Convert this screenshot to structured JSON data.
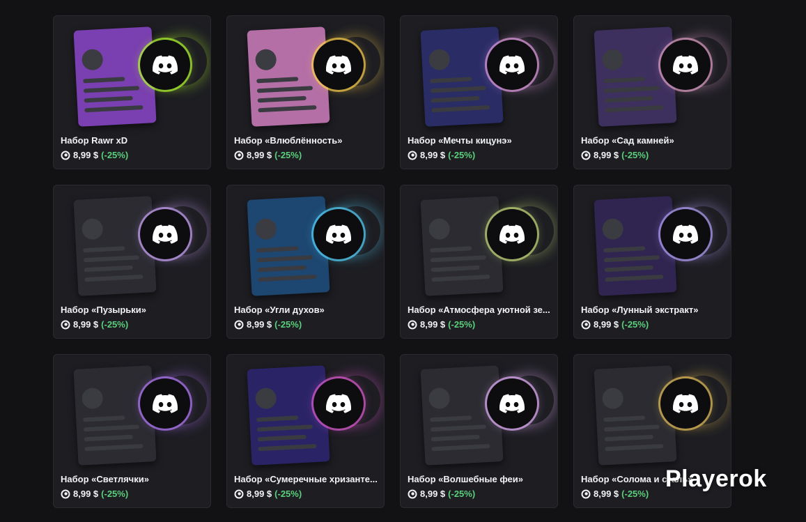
{
  "currency_icon": "orb-icon",
  "items": [
    {
      "title": "Набор Rawr xD",
      "price": "8,99 $",
      "discount": "(-25%)",
      "bg": "#7a3fb0",
      "accent": "#b6ff2e"
    },
    {
      "title": "Набор «Влюблённость»",
      "price": "8,99 $",
      "discount": "(-25%)",
      "bg": "#b46fa7",
      "accent": "#ffd24a"
    },
    {
      "title": "Набор «Мечты кицунэ»",
      "price": "8,99 $",
      "discount": "(-25%)",
      "bg": "#2a2c66",
      "accent": "#e7a0e6"
    },
    {
      "title": "Набор «Сад камней»",
      "price": "8,99 $",
      "discount": "(-25%)",
      "bg": "#3d2f5e",
      "accent": "#e2a0c8"
    },
    {
      "title": "Набор «Пузырьки»",
      "price": "8,99 $",
      "discount": "(-25%)",
      "bg": "#2b2b31",
      "accent": "#d1a8ff"
    },
    {
      "title": "Набор «Угли духов»",
      "price": "8,99 $",
      "discount": "(-25%)",
      "bg": "#1d4670",
      "accent": "#56d7ff"
    },
    {
      "title": "Набор «Атмосфера уютной зе...",
      "price": "8,99 $",
      "discount": "(-25%)",
      "bg": "#2b2b31",
      "accent": "#c9e07c"
    },
    {
      "title": "Набор «Лунный экстракт»",
      "price": "8,99 $",
      "discount": "(-25%)",
      "bg": "#2f2550",
      "accent": "#b9a4ff"
    },
    {
      "title": "Набор «Светлячки»",
      "price": "8,99 $",
      "discount": "(-25%)",
      "bg": "#2b2b31",
      "accent": "#b77bff"
    },
    {
      "title": "Набор «Сумеречные хризанте...",
      "price": "8,99 $",
      "discount": "(-25%)",
      "bg": "#2a2467",
      "accent": "#e05bd3"
    },
    {
      "title": "Набор «Волшебные феи»",
      "price": "8,99 $",
      "discount": "(-25%)",
      "bg": "#2b2b31",
      "accent": "#e9b4ff"
    },
    {
      "title": "Набор «Солома и сталь»",
      "price": "8,99 $",
      "discount": "(-25%)",
      "bg": "#2b2b31",
      "accent": "#e8c15a"
    }
  ],
  "watermark": "Playerok"
}
